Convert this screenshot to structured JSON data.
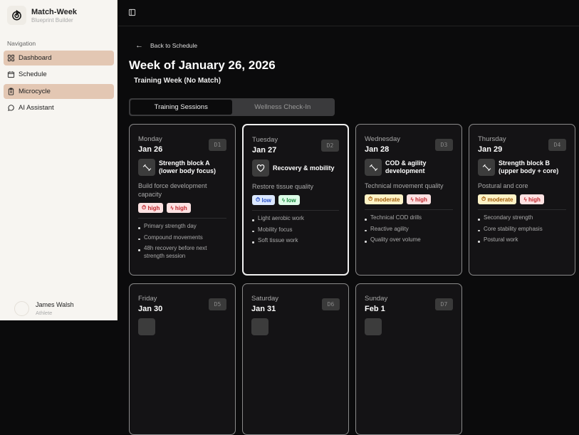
{
  "app": {
    "title": "Match-Week",
    "subtitle": "Blueprint Builder"
  },
  "sidebar": {
    "section_label": "Navigation",
    "items": [
      {
        "label": "Dashboard",
        "icon": "grid-icon",
        "active": true
      },
      {
        "label": "Schedule",
        "icon": "calendar-icon",
        "active": false
      },
      {
        "label": "Microcycle",
        "icon": "clipboard-icon",
        "active": true
      },
      {
        "label": "AI Assistant",
        "icon": "chat-icon",
        "active": false
      }
    ]
  },
  "user": {
    "name": "James Walsh",
    "role": "Athlete"
  },
  "main": {
    "back_label": "Back to Schedule",
    "title": "Week of January 26, 2026",
    "subtitle": "Training Week (No Match)",
    "tabs": [
      {
        "label": "Training Sessions",
        "active": true
      },
      {
        "label": "Wellness Check-In",
        "active": false
      }
    ]
  },
  "days": [
    {
      "day": "Monday",
      "date": "Jan 26",
      "code": "D1",
      "icon": "dumbbell-icon",
      "session": "Strength block A (lower body focus)",
      "goal": "Build force development capacity",
      "intensity": "high",
      "load": "high",
      "notes": [
        "Primary strength day",
        "Compound movements",
        "48h recovery before next strength session"
      ]
    },
    {
      "day": "Tuesday",
      "date": "Jan 27",
      "code": "D2",
      "icon": "heart-icon",
      "session": "Recovery & mobility",
      "goal": "Restore tissue quality",
      "intensity": "low",
      "load": "low",
      "notes": [
        "Light aerobic work",
        "Mobility focus",
        "Soft tissue work"
      ],
      "selected": true
    },
    {
      "day": "Wednesday",
      "date": "Jan 28",
      "code": "D3",
      "icon": "dumbbell-icon",
      "session": "COD & agility development",
      "goal": "Technical movement quality",
      "intensity": "moderate",
      "load": "high",
      "notes": [
        "Technical COD drills",
        "Reactive agility",
        "Quality over volume"
      ]
    },
    {
      "day": "Thursday",
      "date": "Jan 29",
      "code": "D4",
      "icon": "dumbbell-icon",
      "session": "Strength block B (upper body + core)",
      "goal": "Postural and core",
      "intensity": "moderate",
      "load": "high",
      "notes": [
        "Secondary strength",
        "Core stability emphasis",
        "Postural work"
      ]
    },
    {
      "day": "Friday",
      "date": "Jan 30",
      "code": "D5"
    },
    {
      "day": "Saturday",
      "date": "Jan 31",
      "code": "D6"
    },
    {
      "day": "Sunday",
      "date": "Feb 1",
      "code": "D7"
    }
  ]
}
